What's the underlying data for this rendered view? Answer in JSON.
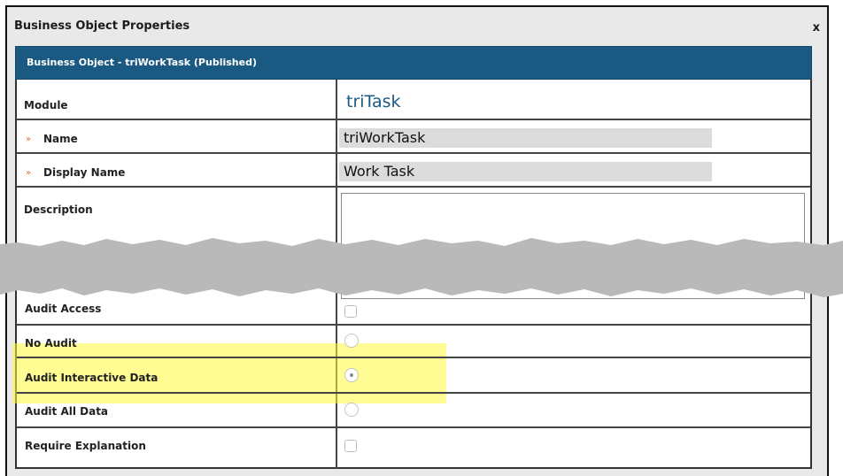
{
  "dialog": {
    "title": "Business Object Properties",
    "close_label": "x",
    "header": "Business Object - triWorkTask (Published)"
  },
  "fields": {
    "module": {
      "label": "Module",
      "value": "triTask"
    },
    "name": {
      "label": "Name",
      "required_marker": "»",
      "value": "triWorkTask"
    },
    "display_name": {
      "label": "Display Name",
      "required_marker": "»",
      "value": "Work Task"
    },
    "description": {
      "label": "Description",
      "value": ""
    }
  },
  "audit": {
    "audit_access": {
      "label": "Audit Access",
      "checked": false
    },
    "no_audit": {
      "label": "No Audit",
      "selected": false
    },
    "audit_interactive_data": {
      "label": "Audit Interactive Data",
      "selected": true
    },
    "audit_all_data": {
      "label": "Audit All Data",
      "selected": false
    },
    "require_explanation": {
      "label": "Require Explanation",
      "checked": false
    }
  },
  "colors": {
    "header_bar": "#1a5a82",
    "module_value": "#1a5a82",
    "required_marker": "#e06a2a",
    "highlight": "#fffa3c"
  }
}
